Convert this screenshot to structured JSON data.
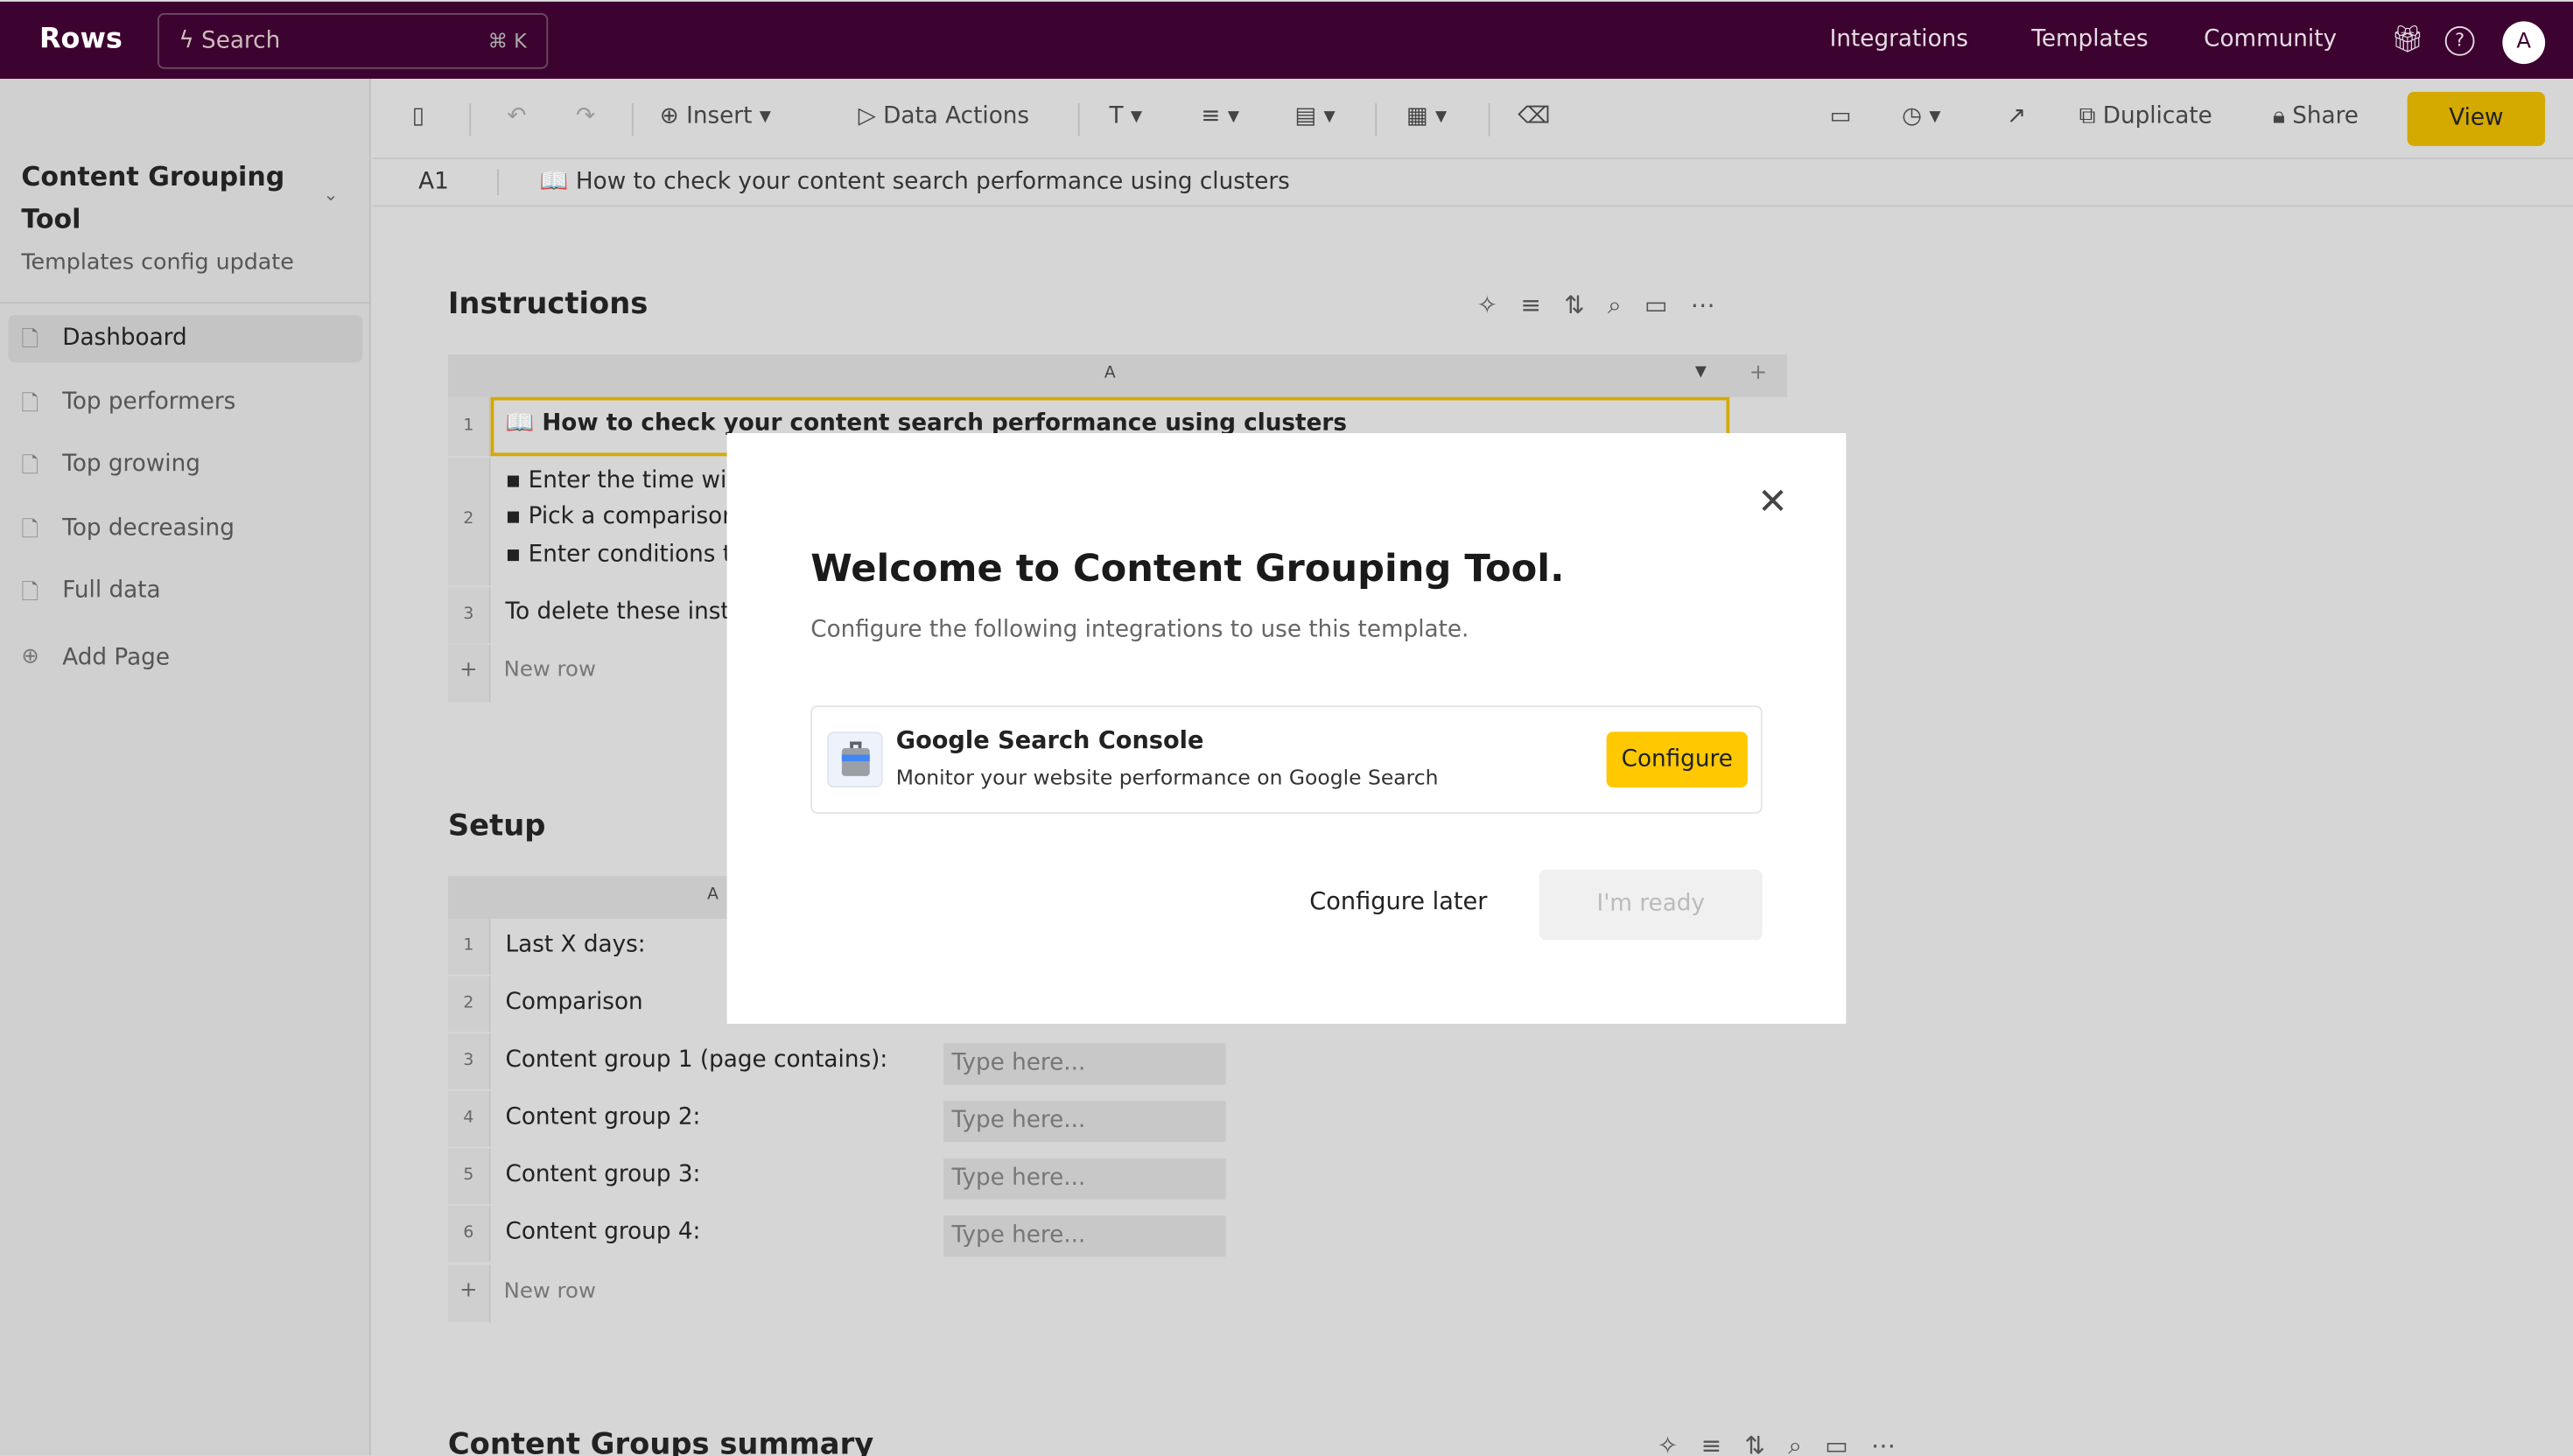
{
  "topbar": {
    "logo": "Rows",
    "search_placeholder": "Search",
    "search_shortcut": "⌘ K",
    "nav": [
      "Integrations",
      "Templates",
      "Community"
    ],
    "avatar": "A",
    "brand_color": "#3d0330"
  },
  "sidebar": {
    "doc_title": "Content Grouping Tool",
    "doc_subtitle": "Templates config update",
    "pages": [
      "Dashboard",
      "Top performers",
      "Top growing",
      "Top decreasing",
      "Full data"
    ],
    "add_page": "Add Page"
  },
  "toolbar": {
    "insert": "Insert",
    "data_actions": "Data Actions",
    "duplicate": "Duplicate",
    "share": "Share",
    "view": "View",
    "accent": "#ffc800"
  },
  "formula_bar": {
    "cell_ref": "A1",
    "value": "📖 How to check your content search performance using clusters"
  },
  "instructions": {
    "title": "Instructions",
    "column": "A",
    "rows": [
      {
        "n": "1",
        "text": "📖  How to check your content search performance using clusters"
      },
      {
        "n": "2",
        "lines": [
          "▪ Enter the time wir",
          "▪ Pick a comparison",
          "▪ Enter conditions t"
        ]
      },
      {
        "n": "3",
        "text": "To delete these inst"
      }
    ],
    "new_row": "New row"
  },
  "setup": {
    "title": "Setup",
    "column": "A",
    "rows": [
      {
        "n": "1",
        "label": "Last X days:",
        "placeholder": ""
      },
      {
        "n": "2",
        "label": "Comparison",
        "placeholder": ""
      },
      {
        "n": "3",
        "label": "Content group 1 (page contains):",
        "placeholder": "Type here..."
      },
      {
        "n": "4",
        "label": "Content group 2:",
        "placeholder": "Type here..."
      },
      {
        "n": "5",
        "label": "Content group 3:",
        "placeholder": "Type here..."
      },
      {
        "n": "6",
        "label": "Content group 4:",
        "placeholder": "Type here..."
      }
    ],
    "new_row": "New row"
  },
  "summary": {
    "title": "Content Groups summary"
  },
  "modal": {
    "title": "Welcome to Content Grouping Tool.",
    "subtitle": "Configure the following integrations to use this template.",
    "integration": {
      "name": "Google Search Console",
      "description": "Monitor your website performance on Google Search",
      "button": "Configure"
    },
    "configure_later": "Configure later",
    "ready": "I'm ready"
  }
}
